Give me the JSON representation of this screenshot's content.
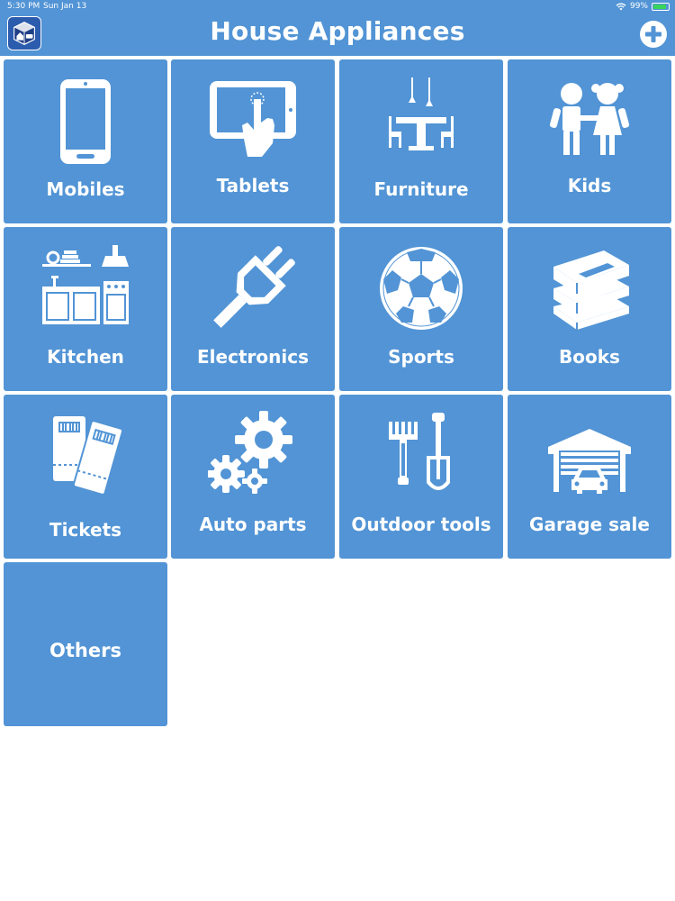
{
  "status_bar": {
    "time": "5:30 PM",
    "date": "Sun Jan 13",
    "battery": "99%"
  },
  "header": {
    "title": "House Appliances",
    "logo_icon": "house-cube-icon",
    "add_icon": "plus-circle-icon"
  },
  "tiles": [
    {
      "label": "Mobiles",
      "icon": "mobile-phone-icon"
    },
    {
      "label": "Tablets",
      "icon": "tablet-touch-icon"
    },
    {
      "label": "Furniture",
      "icon": "dining-table-icon"
    },
    {
      "label": "Kids",
      "icon": "children-icon"
    },
    {
      "label": "Kitchen",
      "icon": "kitchen-icon"
    },
    {
      "label": "Electronics",
      "icon": "plug-icon"
    },
    {
      "label": "Sports",
      "icon": "soccer-ball-icon"
    },
    {
      "label": "Books",
      "icon": "books-icon"
    },
    {
      "label": "Tickets",
      "icon": "tickets-icon"
    },
    {
      "label": "Auto parts",
      "icon": "gears-icon"
    },
    {
      "label": "Outdoor tools",
      "icon": "garden-tools-icon"
    },
    {
      "label": "Garage sale",
      "icon": "garage-icon"
    },
    {
      "label": "Others",
      "icon": ""
    }
  ],
  "colors": {
    "header_bg": "#5294d5",
    "tile_bg": "#5294d5",
    "text": "#ffffff",
    "page_bg": "#ffffff"
  }
}
